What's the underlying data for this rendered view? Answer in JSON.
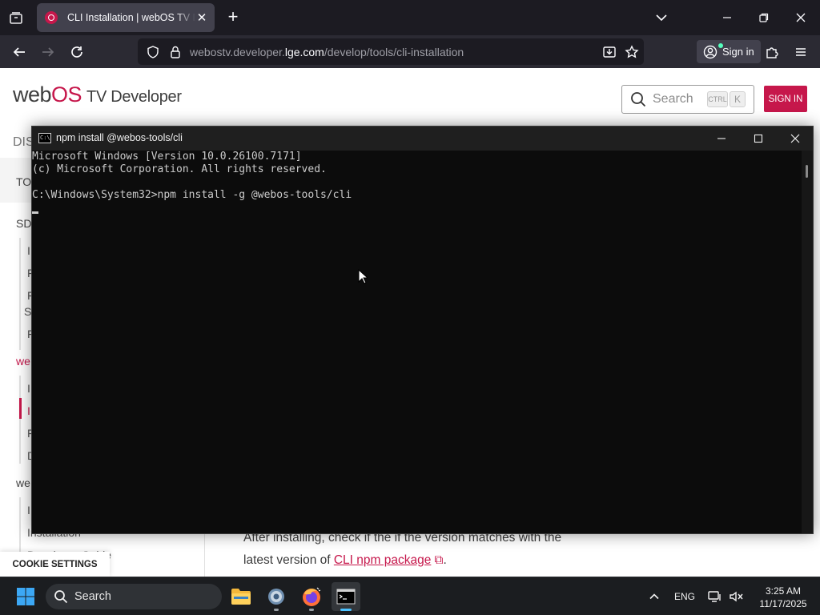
{
  "browser": {
    "tab_title": "CLI Installation | webOS TV Developer",
    "url_prefix": "webostv.developer.",
    "url_domain": "lge.com",
    "url_path": "/develop/tools/cli-installation",
    "account_label": "Sign in"
  },
  "site": {
    "logo_brand_a": "web",
    "logo_brand_b": "OS",
    "logo_sub": "TV Developer",
    "search_placeholder": "Search",
    "kbd_ctrl": "CTRL",
    "kbd_k": "K",
    "signin_label": "SIGN IN",
    "nav_partial": "DIS",
    "sidebar": {
      "section_top": "TO",
      "section_sdk": "SD",
      "items_a": [
        "I",
        "F",
        "F",
        "S",
        "F"
      ],
      "section_web": "we",
      "items_b": [
        "I",
        "I",
        "F",
        "D"
      ],
      "section_web2": "we",
      "items_c": [
        "I",
        "Installation",
        "Developer Guide"
      ]
    },
    "content_line1": "After installing, check if the if the version matches with the",
    "content_line2_pre": "latest version of ",
    "content_link": "CLI npm package",
    "content_line2_post": ".",
    "cookie_label": "COOKIE SETTINGS",
    "accent_color": "#c6174b"
  },
  "terminal": {
    "title": "npm install @webos-tools/cli",
    "lines": [
      "Microsoft Windows [Version 10.0.26100.7171]",
      "(c) Microsoft Corporation. All rights reserved.",
      "",
      "C:\\Windows\\System32>npm install -g @webos-tools/cli"
    ]
  },
  "taskbar": {
    "search_placeholder": "Search",
    "language": "ENG",
    "time": "3:25 AM",
    "date": "11/17/2025",
    "apps": [
      "file-explorer",
      "settings",
      "firefox",
      "command-prompt"
    ]
  }
}
